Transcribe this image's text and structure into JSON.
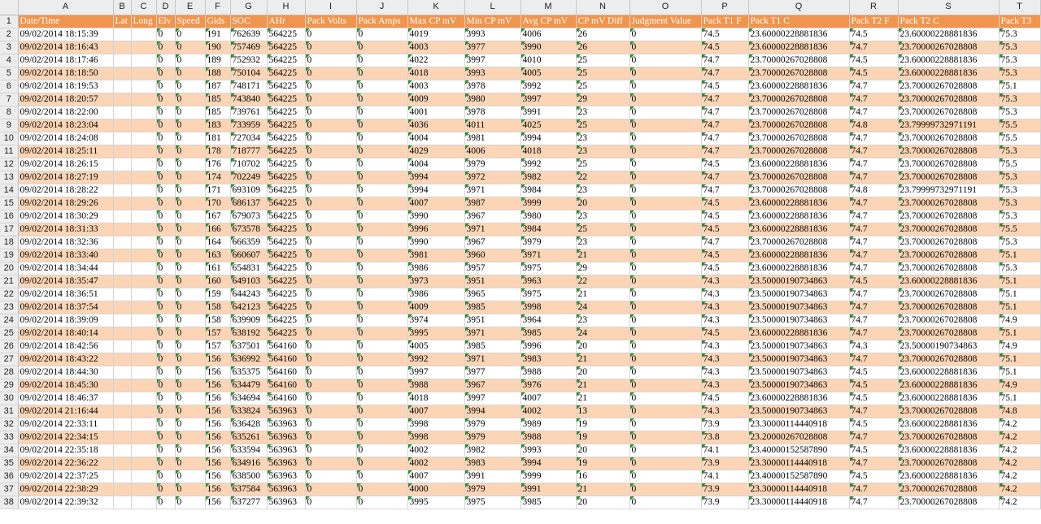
{
  "spreadsheet": {
    "column_letters": [
      "A",
      "B",
      "C",
      "D",
      "E",
      "F",
      "G",
      "H",
      "I",
      "J",
      "K",
      "L",
      "M",
      "N",
      "O",
      "P",
      "Q",
      "R",
      "S",
      "T"
    ],
    "header_row_number": "1",
    "headers": [
      "Date/Time",
      "Lat",
      "Long",
      "Elv",
      "Speed",
      "Gids",
      "SOC",
      "AHr",
      "Pack Volts",
      "Pack Amps",
      "Max CP mV",
      "Min CP mV",
      "Avg CP mV",
      "CP mV Diff",
      "Judgment Value",
      "Pack T1 F",
      "Pack T1 C",
      "Pack T2 F",
      "Pack T2 C",
      "Pack T3"
    ],
    "rows": [
      {
        "n": "2",
        "cells": [
          "09/02/2014 18:15:39",
          "",
          "",
          "0",
          "0",
          "191",
          "762639",
          "564225",
          "0",
          "0",
          "4019",
          "3993",
          "4006",
          "26",
          "0",
          "74.5",
          "23.60000228881836",
          "74.5",
          "23.60000228881836",
          "75.3"
        ]
      },
      {
        "n": "3",
        "cells": [
          "09/02/2014 18:16:43",
          "",
          "",
          "0",
          "0",
          "190",
          "757469",
          "564225",
          "0",
          "0",
          "4003",
          "3977",
          "3990",
          "26",
          "0",
          "74.5",
          "23.60000228881836",
          "74.7",
          "23.70000267028808",
          "75.3"
        ]
      },
      {
        "n": "4",
        "cells": [
          "09/02/2014 18:17:46",
          "",
          "",
          "0",
          "0",
          "189",
          "752932",
          "564225",
          "0",
          "0",
          "4022",
          "3997",
          "4010",
          "25",
          "0",
          "74.7",
          "23.70000267028808",
          "74.5",
          "23.60000228881836",
          "75.3"
        ]
      },
      {
        "n": "5",
        "cells": [
          "09/02/2014 18:18:50",
          "",
          "",
          "0",
          "0",
          "188",
          "750104",
          "564225",
          "0",
          "0",
          "4018",
          "3993",
          "4005",
          "25",
          "0",
          "74.7",
          "23.70000267028808",
          "74.5",
          "23.60000228881836",
          "75.3"
        ]
      },
      {
        "n": "6",
        "cells": [
          "09/02/2014 18:19:53",
          "",
          "",
          "0",
          "0",
          "187",
          "748171",
          "564225",
          "0",
          "0",
          "4003",
          "3978",
          "3992",
          "25",
          "0",
          "74.5",
          "23.60000228881836",
          "74.7",
          "23.70000267028808",
          "75.1"
        ]
      },
      {
        "n": "7",
        "cells": [
          "09/02/2014 18:20:57",
          "",
          "",
          "0",
          "0",
          "185",
          "743840",
          "564225",
          "0",
          "0",
          "4009",
          "3980",
          "3997",
          "29",
          "0",
          "74.7",
          "23.70000267028808",
          "74.7",
          "23.70000267028808",
          "75.3"
        ]
      },
      {
        "n": "8",
        "cells": [
          "09/02/2014 18:22:00",
          "",
          "",
          "0",
          "0",
          "185",
          "739761",
          "564225",
          "0",
          "0",
          "4001",
          "3978",
          "3991",
          "23",
          "0",
          "74.7",
          "23.70000267028808",
          "74.7",
          "23.70000267028808",
          "75.3"
        ]
      },
      {
        "n": "9",
        "cells": [
          "09/02/2014 18:23:04",
          "",
          "",
          "0",
          "0",
          "183",
          "733959",
          "564225",
          "0",
          "0",
          "4036",
          "4011",
          "4025",
          "25",
          "0",
          "74.7",
          "23.70000267028808",
          "74.8",
          "23.79999732971191",
          "75.5"
        ]
      },
      {
        "n": "10",
        "cells": [
          "09/02/2014 18:24:08",
          "",
          "",
          "0",
          "0",
          "181",
          "727034",
          "564225",
          "0",
          "0",
          "4004",
          "3981",
          "3994",
          "23",
          "0",
          "74.7",
          "23.70000267028808",
          "74.7",
          "23.70000267028808",
          "75.5"
        ]
      },
      {
        "n": "11",
        "cells": [
          "09/02/2014 18:25:11",
          "",
          "",
          "0",
          "0",
          "178",
          "718777",
          "564225",
          "0",
          "0",
          "4029",
          "4006",
          "4018",
          "23",
          "0",
          "74.7",
          "23.70000267028808",
          "74.7",
          "23.70000267028808",
          "75.3"
        ]
      },
      {
        "n": "12",
        "cells": [
          "09/02/2014 18:26:15",
          "",
          "",
          "0",
          "0",
          "176",
          "710702",
          "564225",
          "0",
          "0",
          "4004",
          "3979",
          "3992",
          "25",
          "0",
          "74.5",
          "23.60000228881836",
          "74.7",
          "23.70000267028808",
          "75.5"
        ]
      },
      {
        "n": "13",
        "cells": [
          "09/02/2014 18:27:19",
          "",
          "",
          "0",
          "0",
          "174",
          "702249",
          "564225",
          "0",
          "0",
          "3994",
          "3972",
          "3982",
          "22",
          "0",
          "74.7",
          "23.70000267028808",
          "74.7",
          "23.70000267028808",
          "75.3"
        ]
      },
      {
        "n": "14",
        "cells": [
          "09/02/2014 18:28:22",
          "",
          "",
          "0",
          "0",
          "171",
          "693109",
          "564225",
          "0",
          "0",
          "3994",
          "3971",
          "3984",
          "23",
          "0",
          "74.7",
          "23.70000267028808",
          "74.8",
          "23.79999732971191",
          "75.3"
        ]
      },
      {
        "n": "15",
        "cells": [
          "09/02/2014 18:29:26",
          "",
          "",
          "0",
          "0",
          "170",
          "686137",
          "564225",
          "0",
          "0",
          "4007",
          "3987",
          "3999",
          "20",
          "0",
          "74.5",
          "23.60000228881836",
          "74.7",
          "23.70000267028808",
          "75.3"
        ]
      },
      {
        "n": "16",
        "cells": [
          "09/02/2014 18:30:29",
          "",
          "",
          "0",
          "0",
          "167",
          "679073",
          "564225",
          "0",
          "0",
          "3990",
          "3967",
          "3980",
          "23",
          "0",
          "74.5",
          "23.60000228881836",
          "74.7",
          "23.70000267028808",
          "75.3"
        ]
      },
      {
        "n": "17",
        "cells": [
          "09/02/2014 18:31:33",
          "",
          "",
          "0",
          "0",
          "166",
          "673578",
          "564225",
          "0",
          "0",
          "3996",
          "3971",
          "3984",
          "25",
          "0",
          "74.5",
          "23.60000228881836",
          "74.7",
          "23.70000267028808",
          "75.5"
        ]
      },
      {
        "n": "18",
        "cells": [
          "09/02/2014 18:32:36",
          "",
          "",
          "0",
          "0",
          "164",
          "666359",
          "564225",
          "0",
          "0",
          "3990",
          "3967",
          "3979",
          "23",
          "0",
          "74.7",
          "23.70000267028808",
          "74.7",
          "23.70000267028808",
          "75.3"
        ]
      },
      {
        "n": "19",
        "cells": [
          "09/02/2014 18:33:40",
          "",
          "",
          "0",
          "0",
          "163",
          "660607",
          "564225",
          "0",
          "0",
          "3981",
          "3960",
          "3971",
          "21",
          "0",
          "74.5",
          "23.60000228881836",
          "74.7",
          "23.70000267028808",
          "75.1"
        ]
      },
      {
        "n": "20",
        "cells": [
          "09/02/2014 18:34:44",
          "",
          "",
          "0",
          "0",
          "161",
          "654831",
          "564225",
          "0",
          "0",
          "3986",
          "3957",
          "3975",
          "29",
          "0",
          "74.5",
          "23.60000228881836",
          "74.7",
          "23.70000267028808",
          "75.3"
        ]
      },
      {
        "n": "21",
        "cells": [
          "09/02/2014 18:35:47",
          "",
          "",
          "0",
          "0",
          "160",
          "649103",
          "564225",
          "0",
          "0",
          "3973",
          "3951",
          "3963",
          "22",
          "0",
          "74.3",
          "23.50000190734863",
          "74.5",
          "23.60000228881836",
          "75.1"
        ]
      },
      {
        "n": "22",
        "cells": [
          "09/02/2014 18:36:51",
          "",
          "",
          "0",
          "0",
          "159",
          "644243",
          "564225",
          "0",
          "0",
          "3986",
          "3965",
          "3975",
          "21",
          "0",
          "74.3",
          "23.50000190734863",
          "74.7",
          "23.70000267028808",
          "75.1"
        ]
      },
      {
        "n": "23",
        "cells": [
          "09/02/2014 18:37:54",
          "",
          "",
          "0",
          "0",
          "158",
          "642123",
          "564225",
          "0",
          "0",
          "4009",
          "3985",
          "3998",
          "24",
          "0",
          "74.3",
          "23.50000190734863",
          "74.7",
          "23.70000267028808",
          "75.1"
        ]
      },
      {
        "n": "24",
        "cells": [
          "09/02/2014 18:39:09",
          "",
          "",
          "0",
          "0",
          "158",
          "639909",
          "564225",
          "0",
          "0",
          "3974",
          "3951",
          "3964",
          "23",
          "0",
          "74.3",
          "23.50000190734863",
          "74.7",
          "23.70000267028808",
          "74.9"
        ]
      },
      {
        "n": "25",
        "cells": [
          "09/02/2014 18:40:14",
          "",
          "",
          "0",
          "0",
          "157",
          "638192",
          "564225",
          "0",
          "0",
          "3995",
          "3971",
          "3985",
          "24",
          "0",
          "74.5",
          "23.60000228881836",
          "74.7",
          "23.70000267028808",
          "75.1"
        ]
      },
      {
        "n": "26",
        "cells": [
          "09/02/2014 18:42:56",
          "",
          "",
          "0",
          "0",
          "157",
          "637501",
          "564160",
          "0",
          "0",
          "4005",
          "3985",
          "3996",
          "20",
          "0",
          "74.3",
          "23.50000190734863",
          "74.3",
          "23.50000190734863",
          "74.9"
        ]
      },
      {
        "n": "27",
        "cells": [
          "09/02/2014 18:43:22",
          "",
          "",
          "0",
          "0",
          "156",
          "636992",
          "564160",
          "0",
          "0",
          "3992",
          "3971",
          "3983",
          "21",
          "0",
          "74.3",
          "23.50000190734863",
          "74.7",
          "23.70000267028808",
          "75.1"
        ]
      },
      {
        "n": "28",
        "cells": [
          "09/02/2014 18:44:30",
          "",
          "",
          "0",
          "0",
          "156",
          "635375",
          "564160",
          "0",
          "0",
          "3997",
          "3977",
          "3988",
          "20",
          "0",
          "74.3",
          "23.50000190734863",
          "74.5",
          "23.60000228881836",
          "75.1"
        ]
      },
      {
        "n": "29",
        "cells": [
          "09/02/2014 18:45:30",
          "",
          "",
          "0",
          "0",
          "156",
          "634479",
          "564160",
          "0",
          "0",
          "3988",
          "3967",
          "3976",
          "21",
          "0",
          "74.3",
          "23.50000190734863",
          "74.5",
          "23.60000228881836",
          "74.9"
        ]
      },
      {
        "n": "30",
        "cells": [
          "09/02/2014 18:46:37",
          "",
          "",
          "0",
          "0",
          "156",
          "634694",
          "564160",
          "0",
          "0",
          "4018",
          "3997",
          "4007",
          "21",
          "0",
          "74.5",
          "23.60000228881836",
          "74.5",
          "23.60000228881836",
          "75.1"
        ]
      },
      {
        "n": "31",
        "cells": [
          "09/02/2014 21:16:44",
          "",
          "",
          "0",
          "0",
          "156",
          "633824",
          "563963",
          "0",
          "0",
          "4007",
          "3994",
          "4002",
          "13",
          "0",
          "74.3",
          "23.50000190734863",
          "74.7",
          "23.70000267028808",
          "74.8"
        ]
      },
      {
        "n": "32",
        "cells": [
          "09/02/2014 22:33:11",
          "",
          "",
          "0",
          "0",
          "156",
          "636428",
          "563963",
          "0",
          "0",
          "3998",
          "3979",
          "3989",
          "19",
          "0",
          "73.9",
          "23.30000114440918",
          "74.5",
          "23.60000228881836",
          "74.2"
        ]
      },
      {
        "n": "33",
        "cells": [
          "09/02/2014 22:34:15",
          "",
          "",
          "0",
          "0",
          "156",
          "635261",
          "563963",
          "0",
          "0",
          "3998",
          "3979",
          "3988",
          "19",
          "0",
          "73.8",
          "23.20000267028808",
          "74.7",
          "23.70000267028808",
          "74.2"
        ]
      },
      {
        "n": "34",
        "cells": [
          "09/02/2014 22:35:18",
          "",
          "",
          "0",
          "0",
          "156",
          "633594",
          "563963",
          "0",
          "0",
          "4002",
          "3982",
          "3993",
          "20",
          "0",
          "74.1",
          "23.40000152587890",
          "74.5",
          "23.60000228881836",
          "74.2"
        ]
      },
      {
        "n": "35",
        "cells": [
          "09/02/2014 22:36:22",
          "",
          "",
          "0",
          "0",
          "156",
          "634916",
          "563963",
          "0",
          "0",
          "4002",
          "3983",
          "3994",
          "19",
          "0",
          "73.9",
          "23.30000114440918",
          "74.7",
          "23.70000267028808",
          "74.2"
        ]
      },
      {
        "n": "36",
        "cells": [
          "09/02/2014 22:37:25",
          "",
          "",
          "0",
          "0",
          "156",
          "638500",
          "563963",
          "0",
          "0",
          "4007",
          "3991",
          "3999",
          "16",
          "0",
          "74.1",
          "23.40000152587890",
          "74.5",
          "23.60000228881836",
          "74.2"
        ]
      },
      {
        "n": "37",
        "cells": [
          "09/02/2014 22:38:29",
          "",
          "",
          "0",
          "0",
          "156",
          "637584",
          "563963",
          "0",
          "0",
          "4000",
          "3979",
          "3991",
          "21",
          "0",
          "73.9",
          "23.30000114440918",
          "74.7",
          "23.70000267028808",
          "74.2"
        ]
      },
      {
        "n": "38",
        "cells": [
          "09/02/2014 22:39:32",
          "",
          "",
          "0",
          "0",
          "156",
          "637277",
          "563963",
          "0",
          "0",
          "3995",
          "3975",
          "3985",
          "20",
          "0",
          "73.9",
          "23.30000114440918",
          "74.7",
          "23.70000267028808",
          "74.2"
        ]
      }
    ]
  },
  "colors": {
    "header_fill": "#f0954e",
    "band_fill": "#fbd5b5",
    "gridline": "#d4d4d4",
    "error_indicator": "#2e8b2e"
  }
}
